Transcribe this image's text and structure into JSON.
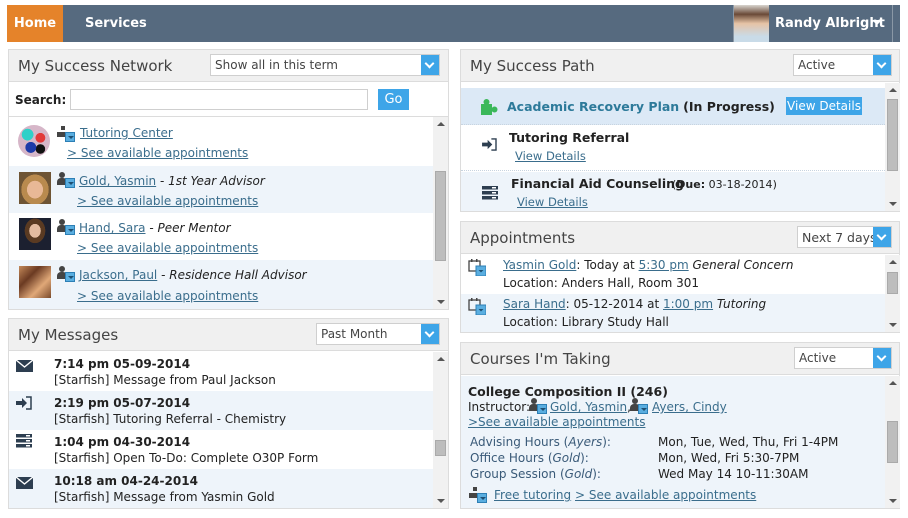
{
  "nav": {
    "tabs": [
      {
        "label": "Home",
        "active": true
      },
      {
        "label": "Services",
        "active": false
      }
    ],
    "user_name": "Randy Albright",
    "accent_color": "#e5832a",
    "bar_color": "#566a7f"
  },
  "success_network": {
    "title": "My Success Network",
    "filter_value": "Show all in this term",
    "search_label": "Search:",
    "search_value": "",
    "search_placeholder": "",
    "go_label": "Go",
    "items": [
      {
        "name": "Tutoring Center",
        "role": "",
        "link": "> See available appointments",
        "type": "org"
      },
      {
        "name": "Gold, Yasmin",
        "role": "1st Year Advisor",
        "link": "> See available appointments",
        "type": "person"
      },
      {
        "name": "Hand, Sara",
        "role": "Peer Mentor",
        "link": "> See available appointments",
        "type": "person"
      },
      {
        "name": "Jackson, Paul",
        "role": "Residence Hall Advisor",
        "link": "> See available appointments",
        "type": "person"
      }
    ],
    "role_separator": " - "
  },
  "messages": {
    "title": "My Messages",
    "filter_value": "Past Month",
    "items": [
      {
        "icon": "envelope-icon",
        "time": "7:14 pm 05-09-2014",
        "subject": "[Starfish] Message from Paul Jackson"
      },
      {
        "icon": "referral-icon",
        "time": "2:19 pm 05-07-2014",
        "subject": "[Starfish] Tutoring Referral - Chemistry"
      },
      {
        "icon": "todo-icon",
        "time": "1:04 pm 04-30-2014",
        "subject": "[Starfish] Open To-Do: Complete O30P Form"
      },
      {
        "icon": "envelope-icon",
        "time": "10:18 am 04-24-2014",
        "subject": "[Starfish] Message from Yasmin Gold"
      }
    ]
  },
  "success_path": {
    "title": "My Success Path",
    "filter_value": "Active",
    "items": [
      {
        "icon": "puzzle-icon",
        "title": "Academic Recovery Plan",
        "status": "(In Progress)",
        "action": "View Details"
      },
      {
        "icon": "referral-icon",
        "title": "Tutoring Referral",
        "action": "View Details"
      },
      {
        "icon": "todo-icon",
        "title": "Financial Aid Counseling",
        "due_label": "Due:",
        "due_date": "03-18-2014",
        "action": "View Details"
      }
    ]
  },
  "appointments": {
    "title": "Appointments",
    "filter_value": "Next 7 days",
    "items": [
      {
        "person": "Yasmin Gold",
        "when": "Today at",
        "time": "5:30 pm",
        "reason": "General Concern",
        "location": "Location: Anders Hall, Room 301"
      },
      {
        "person": "Sara Hand",
        "when": "05-12-2014 at",
        "time": "1:00 pm",
        "reason": "Tutoring",
        "location": "Location: Library Study Hall"
      }
    ]
  },
  "courses": {
    "title": "Courses I'm Taking",
    "filter_value": "Active",
    "course_name": "College Composition II (246)",
    "instructor_label": "Instructor:",
    "instructors": [
      "Gold, Yasmin",
      "Ayers, Cindy"
    ],
    "see_appointments": ">See available appointments",
    "hours": [
      {
        "label": "Advising Hours",
        "who": "Ayers",
        "value": "Mon, Tue, Wed, Thu, Fri 1-4PM"
      },
      {
        "label": "Office Hours",
        "who": "Gold",
        "value": "Mon, Wed, Fri 5:30-7PM"
      },
      {
        "label": "Group Session",
        "who": "Gold",
        "value": "Wed May 14 10-11:30AM"
      }
    ],
    "free_tutoring": "Free tutoring",
    "free_tutoring_appts": "> See available appointments"
  }
}
